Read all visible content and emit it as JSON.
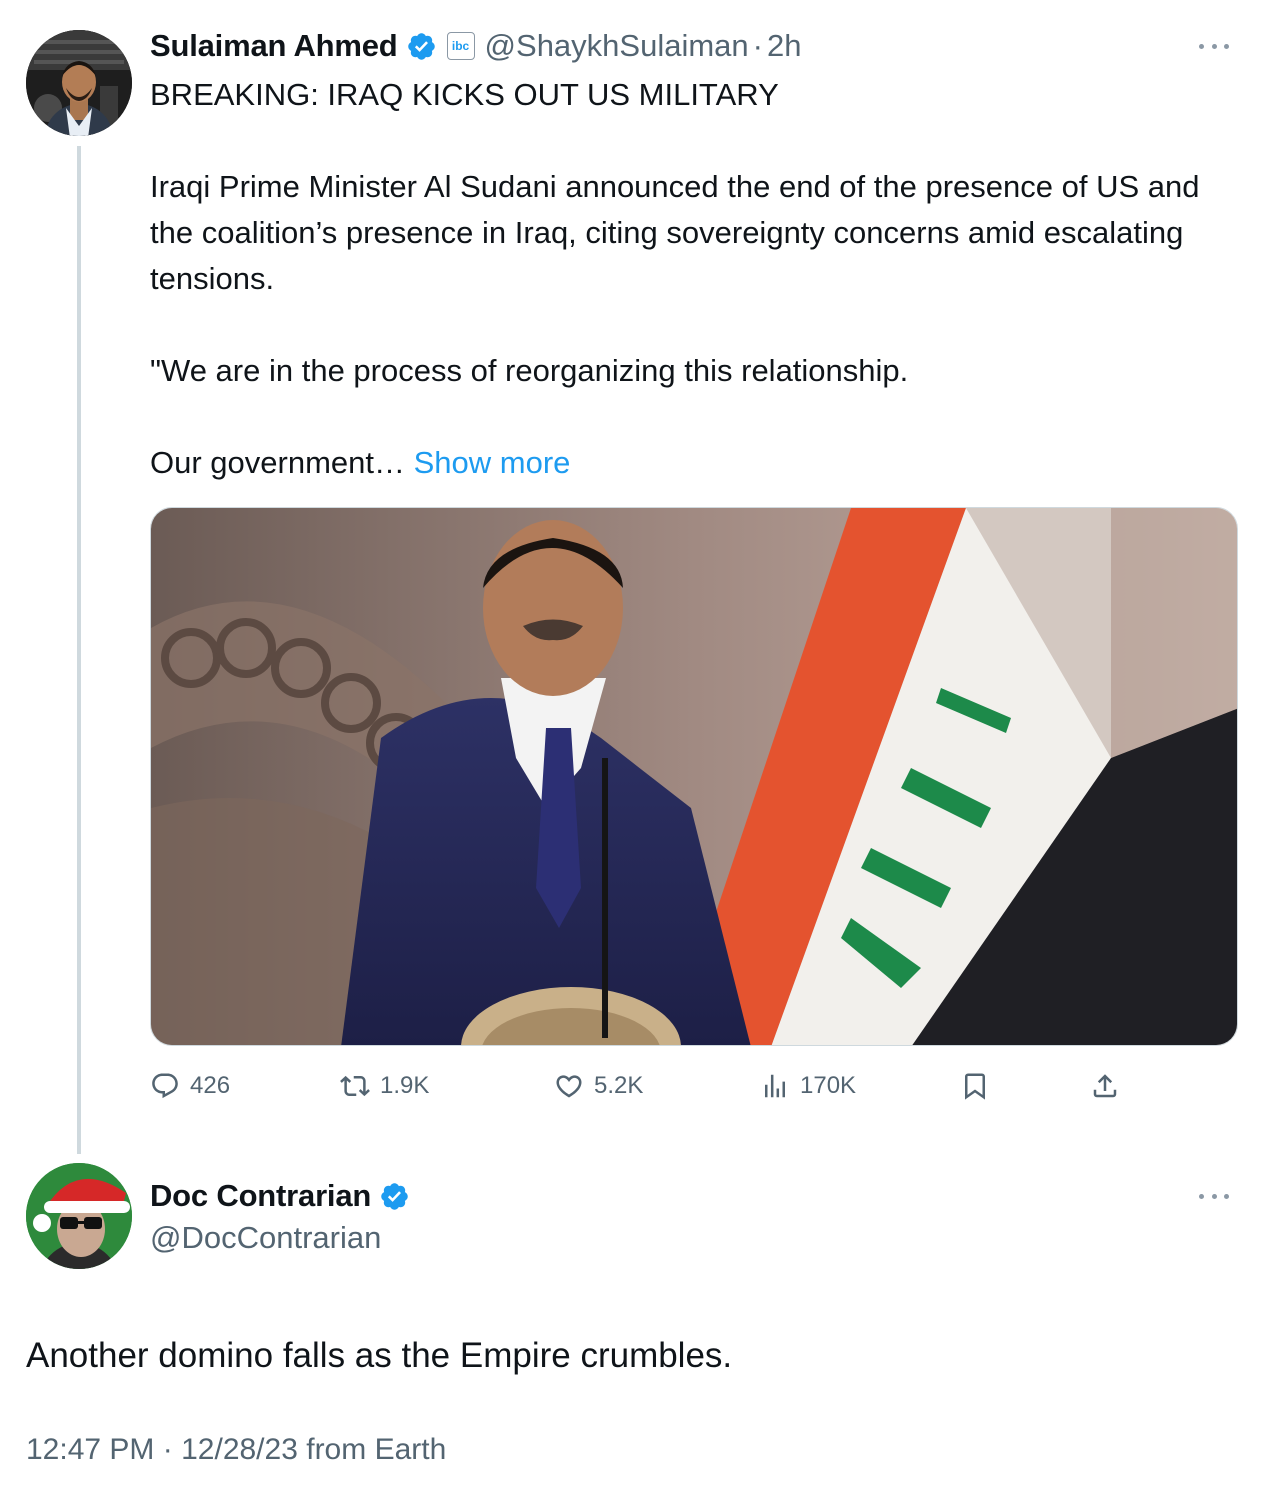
{
  "tweet": {
    "author": {
      "display_name": "Sulaiman Ahmed",
      "verified": true,
      "affiliate_badge_text": "ibc",
      "handle": "@ShaykhSulaiman",
      "separator": "·",
      "time_ago": "2h"
    },
    "text": {
      "headline": "BREAKING: IRAQ KICKS OUT US MILITARY",
      "paragraph1": "Iraqi Prime Minister Al Sudani announced the end of the presence of US and the coalition’s presence in Iraq, citing sovereignty concerns amid escalating tensions.",
      "paragraph2": "\"We are in the process of reorganizing this relationship.",
      "paragraph3": "Our government…",
      "show_more": "Show more"
    },
    "media": {
      "description_icon": "photo-icon"
    },
    "actions": {
      "replies": "426",
      "retweets": "1.9K",
      "likes": "5.2K",
      "views": "170K"
    }
  },
  "reply": {
    "author": {
      "display_name": "Doc Contrarian",
      "verified": true,
      "handle": "@DocContrarian"
    },
    "text": "Another domino falls as the Empire crumbles.",
    "meta": {
      "time": "12:47 PM",
      "separator": "·",
      "date": "12/28/23",
      "source": "from Earth"
    }
  },
  "colors": {
    "text_primary": "#0f1419",
    "text_secondary": "#536471",
    "link": "#1d9bf0",
    "verified": "#1d9bf0",
    "thread_line": "#cfd9de"
  }
}
